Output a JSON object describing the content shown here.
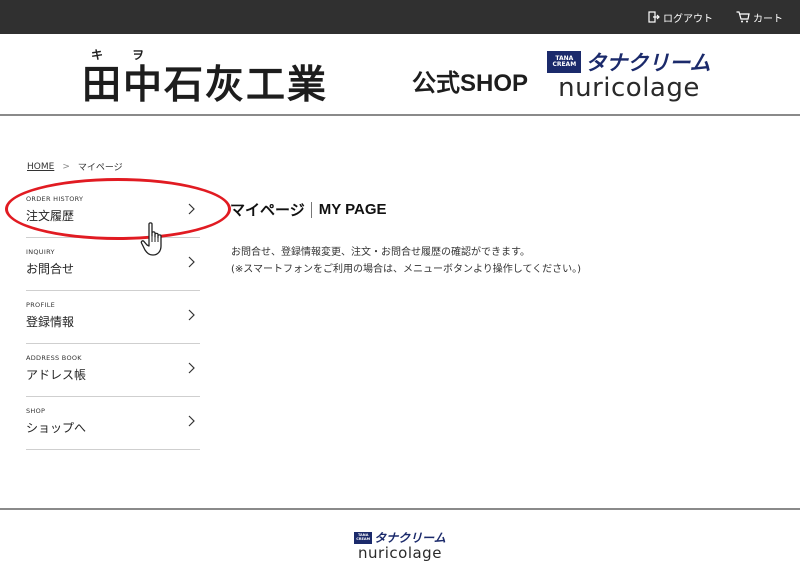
{
  "topbar": {
    "logout_label": "ログアウト",
    "cart_label": "カート",
    "background": "#303030"
  },
  "header": {
    "kanji_logo": {
      "kana_left": "キ",
      "kana_right": "ヲ",
      "name": "田中石灰工業"
    },
    "shop_label": "公式SHOP",
    "tana_logo": {
      "badge_top": "TANA",
      "badge_bottom": "CREAM",
      "kana_name": "タナクリーム",
      "latin_name": "nuricolage",
      "brand_color": "#1b2a6b"
    }
  },
  "breadcrumb": {
    "home": "HOME",
    "separator": ">",
    "current": "マイページ"
  },
  "side_nav": {
    "items": [
      {
        "en": "ORDER HISTORY",
        "ja": "注文履歴"
      },
      {
        "en": "INQUIRY",
        "ja": "お問合せ"
      },
      {
        "en": "PROFILE",
        "ja": "登録情報"
      },
      {
        "en": "ADDRESS BOOK",
        "ja": "アドレス帳"
      },
      {
        "en": "SHOP",
        "ja": "ショップへ"
      }
    ]
  },
  "annotation": {
    "highlight_color": "#e11b22"
  },
  "main": {
    "title_ja": "マイページ",
    "title_en": "MY PAGE",
    "description_line1": "お問合せ、登録情報変更、注文・お問合せ履歴の確認ができます。",
    "description_line2": "(※スマートフォンをご利用の場合は、メニューボタンより操作してください。)"
  },
  "footer": {
    "tana_logo": {
      "badge_top": "TANA",
      "badge_bottom": "CREAM",
      "kana_name": "タナクリーム",
      "latin_name": "nuricolage"
    }
  }
}
